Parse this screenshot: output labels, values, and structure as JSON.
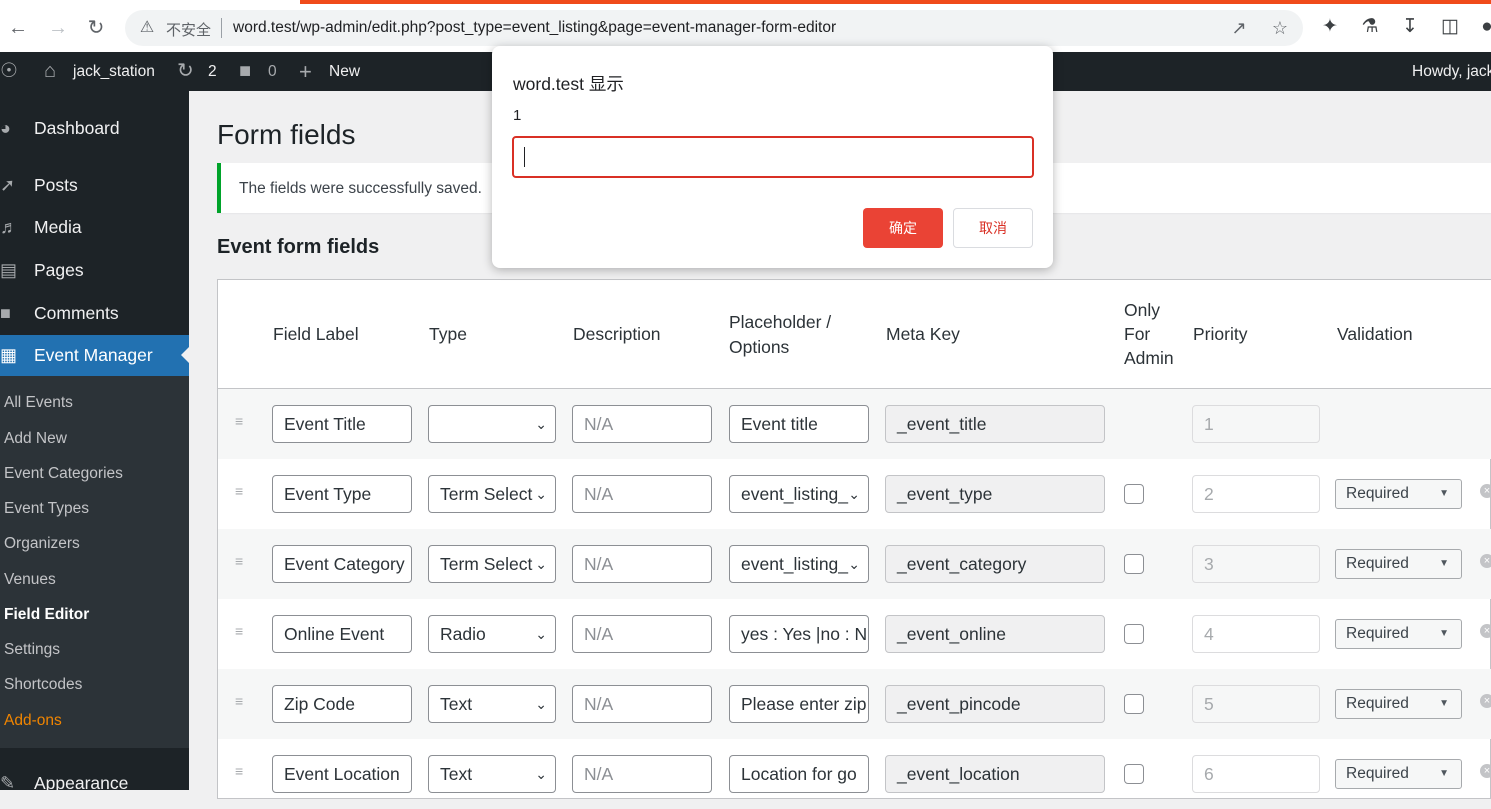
{
  "browser": {
    "insecure_label": "不安全",
    "url": "word.test/wp-admin/edit.php?post_type=event_listing&page=event-manager-form-editor"
  },
  "adminbar": {
    "site_name": "jack_station",
    "updates_count": "2",
    "comments_count": "0",
    "new_label": "New",
    "howdy": "Howdy, jack"
  },
  "sidebar": {
    "dashboard": "Dashboard",
    "posts": "Posts",
    "media": "Media",
    "pages": "Pages",
    "comments": "Comments",
    "event_manager": "Event Manager",
    "submenu": [
      "All Events",
      "Add New",
      "Event Categories",
      "Event Types",
      "Organizers",
      "Venues",
      "Field Editor",
      "Settings",
      "Shortcodes",
      "Add-ons"
    ],
    "appearance": "Appearance"
  },
  "main": {
    "title": "Form fields",
    "notice": "The fields were successfully saved.",
    "section_title": "Event form fields"
  },
  "table": {
    "headers": {
      "label": "Field Label",
      "type": "Type",
      "description": "Description",
      "placeholder_1": "Placeholder /",
      "placeholder_2": "Options",
      "meta_key": "Meta Key",
      "only_1": "Only",
      "only_2": "For",
      "only_3": "Admin",
      "priority": "Priority",
      "validation": "Validation"
    },
    "rows": [
      {
        "label": "Event Title",
        "type": "",
        "description": "N/A",
        "placeholder": "Event title",
        "meta_key": "_event_title",
        "priority": "1",
        "validation": ""
      },
      {
        "label": "Event Type",
        "type": "Term Select",
        "description": "N/A",
        "placeholder": "event_listing_",
        "meta_key": "_event_type",
        "priority": "2",
        "validation": "Required"
      },
      {
        "label": "Event Category",
        "type": "Term Select",
        "description": "N/A",
        "placeholder": "event_listing_",
        "meta_key": "_event_category",
        "priority": "3",
        "validation": "Required"
      },
      {
        "label": "Online Event",
        "type": "Radio",
        "description": "N/A",
        "placeholder": "yes : Yes |no : N",
        "meta_key": "_event_online",
        "priority": "4",
        "validation": "Required"
      },
      {
        "label": "Zip Code",
        "type": "Text",
        "description": "N/A",
        "placeholder": "Please enter zip",
        "meta_key": "_event_pincode",
        "priority": "5",
        "validation": "Required"
      },
      {
        "label": "Event Location",
        "type": "Text",
        "description": "N/A",
        "placeholder": "Location for go",
        "meta_key": "_event_location",
        "priority": "6",
        "validation": "Required"
      }
    ]
  },
  "dialog": {
    "title": "word.test 显示",
    "message": "1",
    "input_value": "",
    "ok_label": "确定",
    "cancel_label": "取消"
  },
  "colors": {
    "admin_bar": "#1d2327",
    "active_menu": "#2271b1",
    "notice_border": "#00a32a",
    "dialog_ok": "#ea4335",
    "addons_link": "#f18500"
  }
}
